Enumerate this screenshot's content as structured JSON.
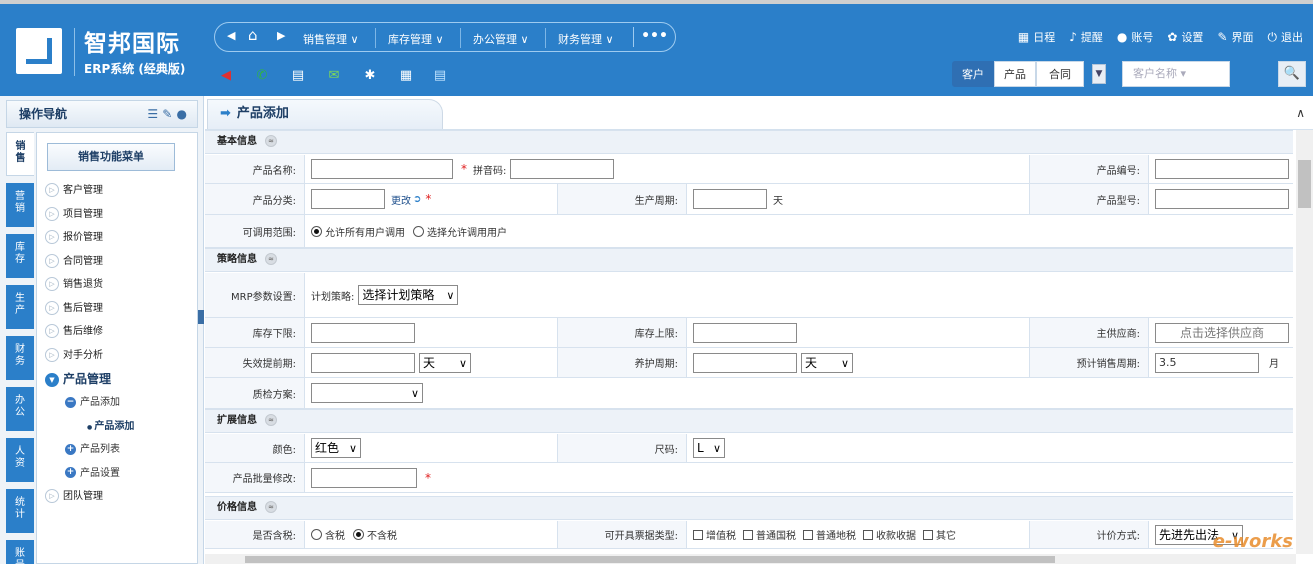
{
  "header": {
    "brand": "智邦国际",
    "edition": "ERP系统 (经典版)",
    "nav_left": "◀",
    "nav_right": "▶",
    "home": "⌂",
    "menus": [
      "销售管理 ∨",
      "库存管理 ∨",
      "办公管理 ∨",
      "财务管理 ∨"
    ],
    "more": "•••",
    "top_links": [
      {
        "icon": "calendar-icon",
        "glyph": "▦",
        "label": "日程"
      },
      {
        "icon": "bell-icon",
        "glyph": "♪",
        "label": "提醒"
      },
      {
        "icon": "user-icon",
        "glyph": "●",
        "label": "账号"
      },
      {
        "icon": "gear-icon",
        "glyph": "✿",
        "label": "设置"
      },
      {
        "icon": "edit-icon",
        "glyph": "✎",
        "label": "界面"
      },
      {
        "icon": "power-icon",
        "glyph": "⏻",
        "label": "退出"
      }
    ],
    "tool_icons": [
      {
        "name": "announce-icon",
        "glyph": "◀",
        "color": "#e03030"
      },
      {
        "name": "phone-icon",
        "glyph": "✆",
        "color": "#2fb24a"
      },
      {
        "name": "fax-icon",
        "glyph": "▤",
        "color": "#ffffff"
      },
      {
        "name": "mail-icon",
        "glyph": "✉",
        "color": "#7ed957"
      },
      {
        "name": "chat-icon",
        "glyph": "✱",
        "color": "#ffffff"
      },
      {
        "name": "grid-icon",
        "glyph": "▦",
        "color": "#ffffff"
      },
      {
        "name": "doc-icon",
        "glyph": "▤",
        "color": "#bfe3ff"
      }
    ],
    "search": {
      "tabs": [
        "客户",
        "产品",
        "合同"
      ],
      "dropdown": "▼",
      "placeholder": "客户名称 ▾",
      "button": "🔍"
    }
  },
  "sidebar": {
    "title": "操作导航",
    "title_icons": "☰ ✎ ●",
    "vtabs": [
      "销售",
      "营销",
      "库存",
      "生产",
      "财务",
      "办公",
      "人资",
      "统计",
      "账号"
    ],
    "menu_button": "销售功能菜单",
    "items": [
      "客户管理",
      "项目管理",
      "报价管理",
      "合同管理",
      "销售退货",
      "售后管理",
      "售后维修",
      "对手分析"
    ],
    "open_item": "产品管理",
    "sub_items": [
      "产品添加",
      "产品列表",
      "产品设置"
    ],
    "active_leaf": "产品添加",
    "last_item": "团队管理"
  },
  "content": {
    "tab_title": "产品添加",
    "sections": {
      "basic": "基本信息",
      "strategy": "策略信息",
      "ext": "扩展信息",
      "price": "价格信息"
    },
    "basic": {
      "name_label": "产品名称:",
      "pinyin_label": "拼音码:",
      "code_label": "产品编号:",
      "category_label": "产品分类:",
      "change_link": "更改",
      "cycle_label": "生产周期:",
      "day_unit": "天",
      "model_label": "产品型号:",
      "scope_label": "可调用范围:",
      "scope_opt1": "允许所有用户调用",
      "scope_opt2": "选择允许调用用户"
    },
    "strategy": {
      "mrp_label": "MRP参数设置:",
      "plan_label": "计划策略:",
      "plan_value": "选择计划策略",
      "min_label": "库存下限:",
      "max_label": "库存上限:",
      "supplier_label": "主供应商:",
      "supplier_placeholder": "点击选择供应商",
      "expire_label": "失效提前期:",
      "expire_unit": "天",
      "care_label": "养护周期:",
      "care_unit": "天",
      "sale_cycle_label": "预计销售周期:",
      "sale_cycle_value": "3.5",
      "month_unit": "月",
      "qc_label": "质检方案:"
    },
    "ext": {
      "color_label": "颜色:",
      "color_value": "红色",
      "size_label": "尺码:",
      "size_value": "L",
      "batch_label": "产品批量修改:"
    },
    "price": {
      "tax_label": "是否含税:",
      "tax_opt1": "含税",
      "tax_opt2": "不含税",
      "invoice_label": "可开具票据类型:",
      "invoice_opts": [
        "增值税",
        "普通国税",
        "普通地税",
        "收款收据",
        "其它"
      ],
      "cost_label": "计价方式:",
      "cost_value": "先进先出法"
    },
    "watermark": "e-works"
  }
}
